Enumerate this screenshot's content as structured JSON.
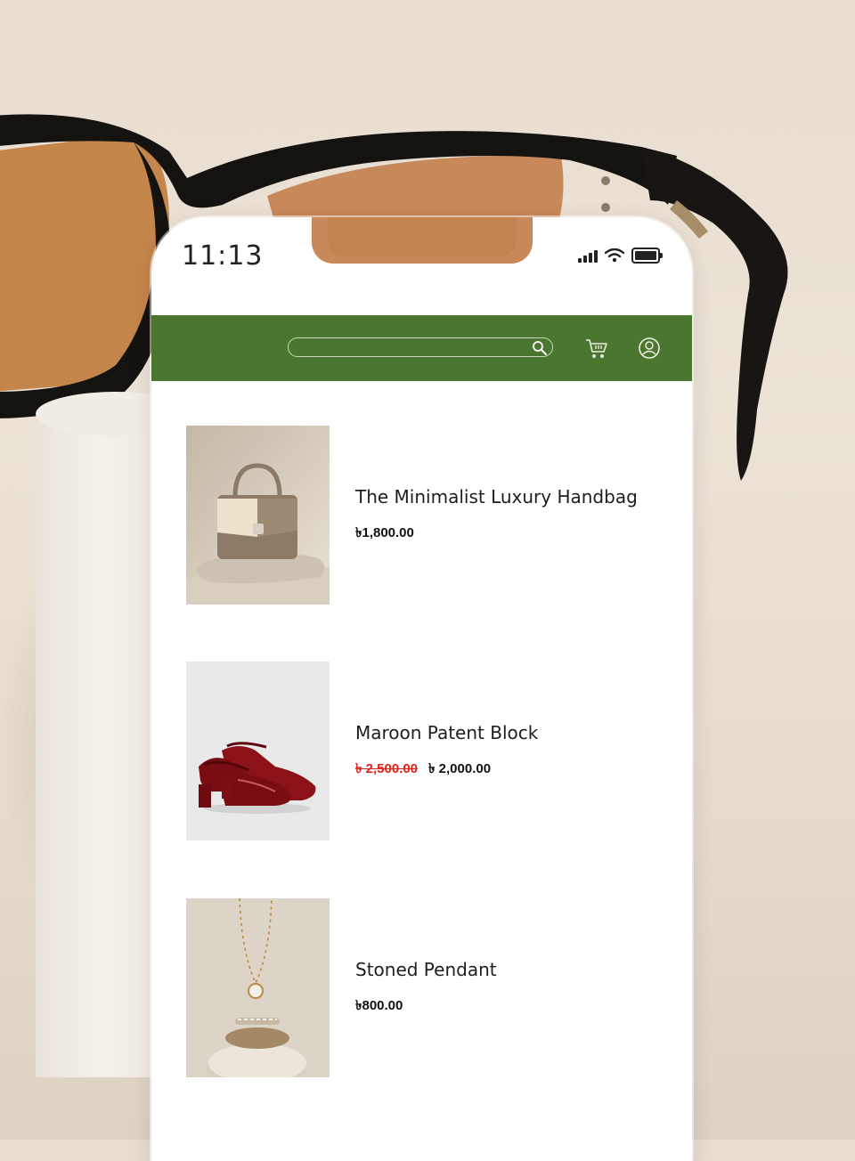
{
  "status_bar": {
    "time": "11:13"
  },
  "header": {
    "search_placeholder": "",
    "colors": {
      "accent": "#4b762f",
      "sale": "#e0241b"
    },
    "icons": [
      "search-icon",
      "cart-icon",
      "user-icon"
    ]
  },
  "products": [
    {
      "name": "The Minimalist Luxury Handbag",
      "price": "৳1,800.00"
    },
    {
      "name": "Maroon Patent Block",
      "old_price": "৳ 2,500.00",
      "price": "৳ 2,000.00"
    },
    {
      "name": "Stoned Pendant",
      "price": "৳800.00"
    }
  ]
}
